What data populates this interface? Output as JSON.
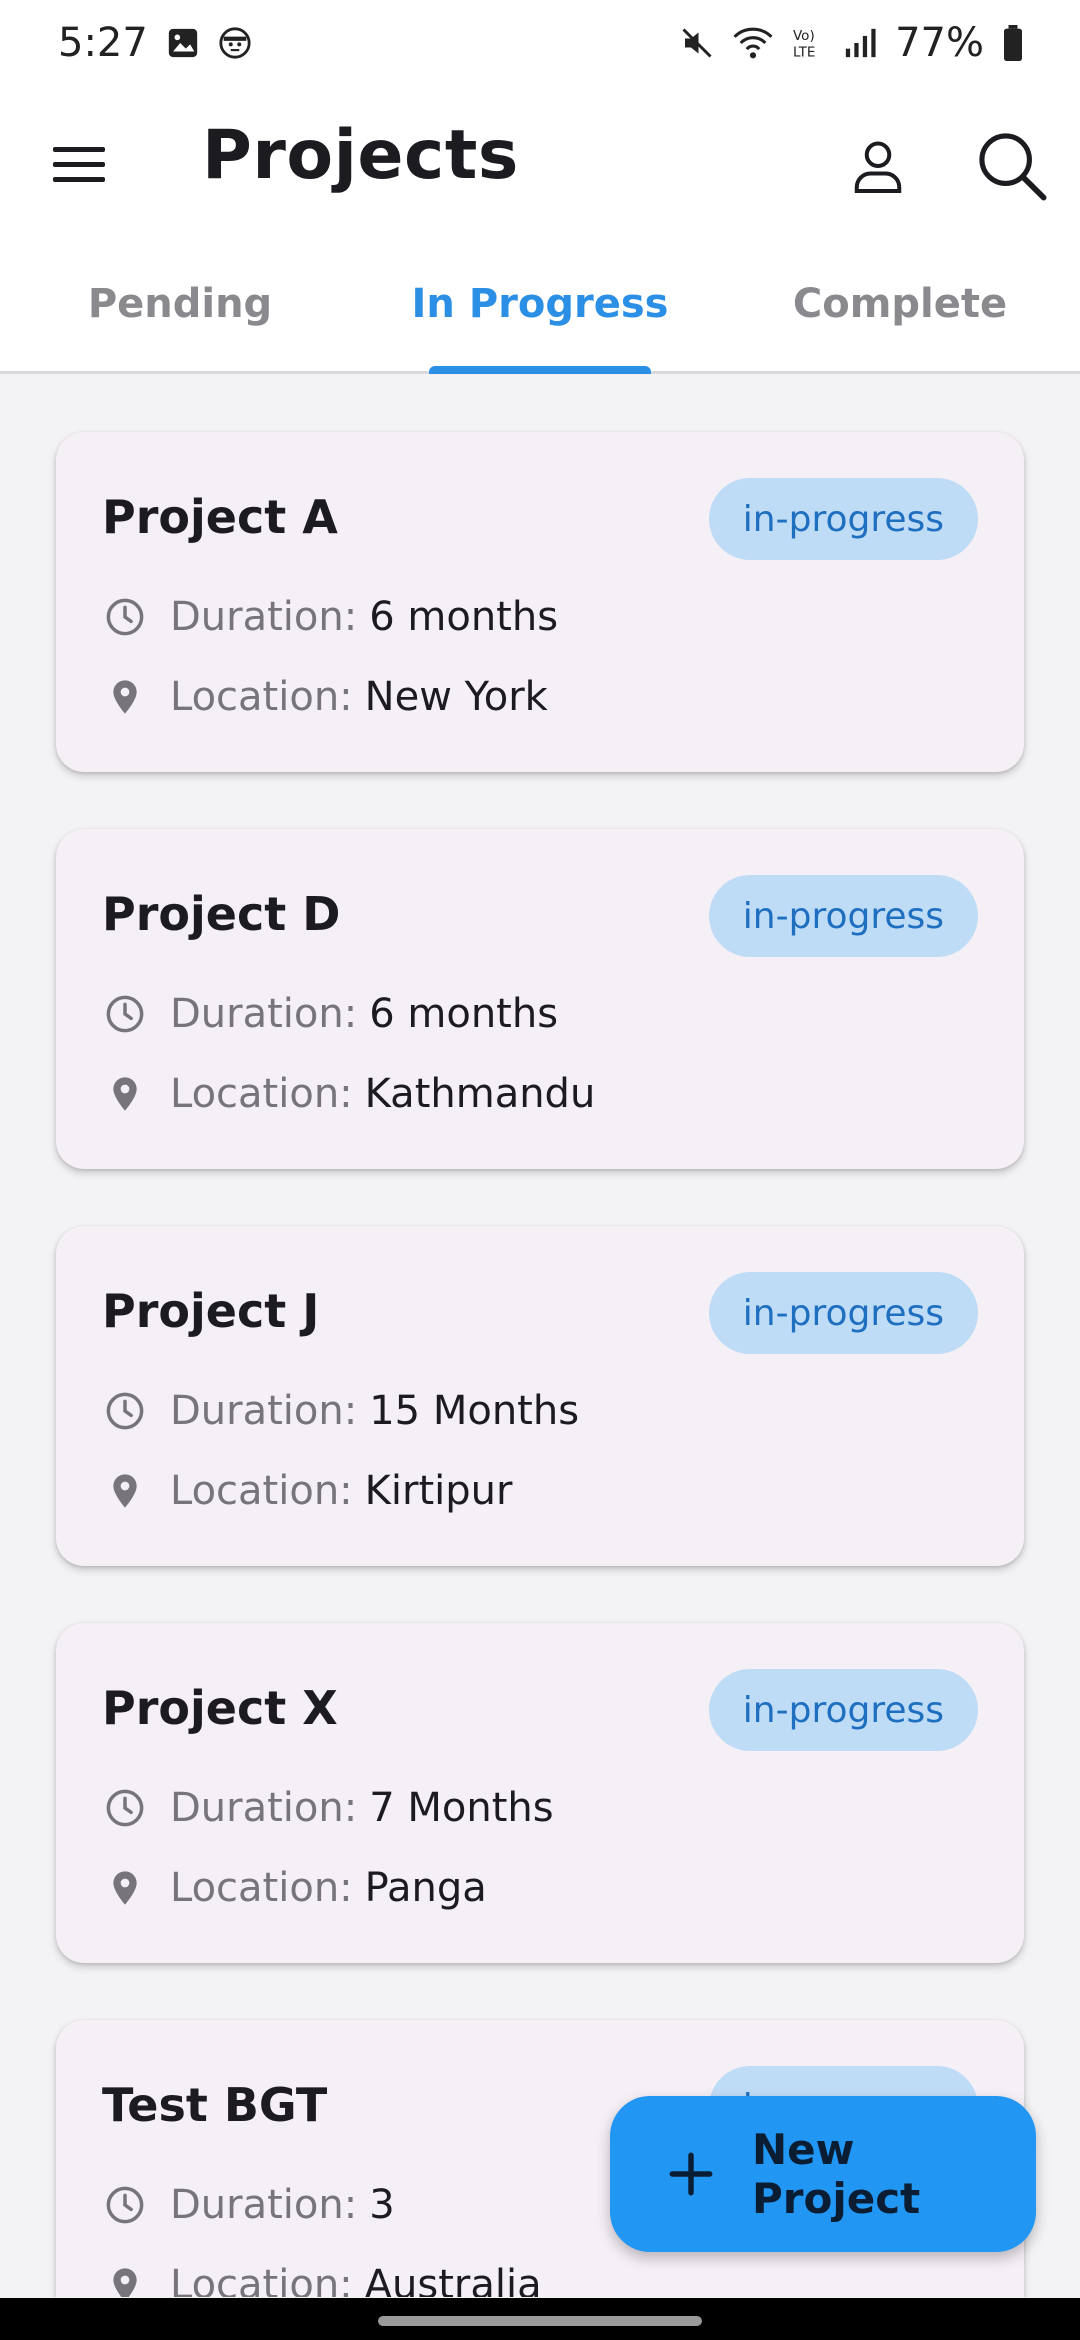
{
  "status_bar": {
    "time": "5:27",
    "battery": "77%",
    "icons": [
      "gallery-icon",
      "face-icon",
      "mute-icon",
      "wifi-icon",
      "volte-icon",
      "signal-icon",
      "battery-icon"
    ]
  },
  "app_bar": {
    "title": "Projects",
    "menu_icon": "hamburger-menu-icon",
    "profile_icon": "person-icon",
    "search_icon": "search-icon"
  },
  "tabs": [
    {
      "label": "Pending",
      "active": false
    },
    {
      "label": "In Progress",
      "active": true
    },
    {
      "label": "Complete",
      "active": false
    }
  ],
  "colors": {
    "accent": "#2b8fe6",
    "badge_bg": "#bfdcf6",
    "badge_text": "#1f6fc0",
    "card_bg": "#f5eff6",
    "fab": "#2196f3"
  },
  "labels": {
    "duration": "Duration:",
    "location": "Location:"
  },
  "projects": [
    {
      "name": "Project A",
      "status": "in-progress",
      "duration": "6 months",
      "location": "New York"
    },
    {
      "name": "Project D",
      "status": "in-progress",
      "duration": "6 months",
      "location": "Kathmandu"
    },
    {
      "name": "Project J",
      "status": "in-progress",
      "duration": "15 Months",
      "location": "Kirtipur"
    },
    {
      "name": "Project X",
      "status": "in-progress",
      "duration": "7 Months",
      "location": "Panga"
    },
    {
      "name": "Test BGT",
      "status": "in-progress",
      "duration": "3",
      "location": "Australia"
    }
  ],
  "fab": {
    "label": "New Project",
    "icon": "plus-icon"
  }
}
